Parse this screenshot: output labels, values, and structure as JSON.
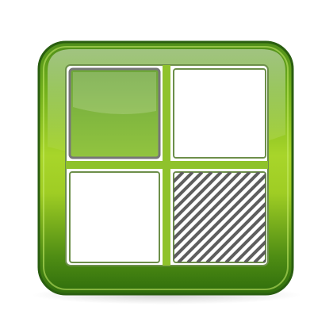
{
  "icon": {
    "name": "delicious-logo-icon",
    "style": "glossy rounded square, 2x2 grid",
    "colors": {
      "body_light": "#a8d52a",
      "body_mid": "#6fae1b",
      "body_dark": "#2f6d0c",
      "outline": "#2a5e10",
      "tile_filled": "#79b13a",
      "tile_white": "#ffffff",
      "tile_frame": "#777777",
      "hatch": "#5e5e5e",
      "background": "#ffffff"
    },
    "tiles": [
      {
        "position": "top-left",
        "fill": "green"
      },
      {
        "position": "top-right",
        "fill": "white"
      },
      {
        "position": "bottom-left",
        "fill": "white"
      },
      {
        "position": "bottom-right",
        "fill": "hatched"
      }
    ]
  }
}
